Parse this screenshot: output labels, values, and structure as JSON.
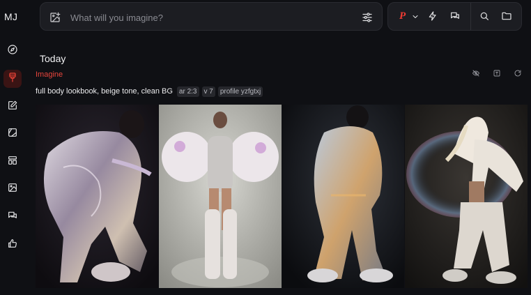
{
  "app": {
    "logo": "MJ"
  },
  "sidebar": {
    "items": [
      {
        "name": "explore",
        "icon": "compass-icon"
      },
      {
        "name": "create",
        "icon": "brush-icon",
        "active": true
      },
      {
        "name": "edit",
        "icon": "edit-icon"
      },
      {
        "name": "personalize",
        "icon": "palette-icon"
      },
      {
        "name": "organize",
        "icon": "layout-icon"
      },
      {
        "name": "gallery",
        "icon": "image-icon"
      },
      {
        "name": "chat",
        "icon": "chat-icon"
      },
      {
        "name": "likes",
        "icon": "thumbs-up-icon"
      }
    ]
  },
  "search": {
    "placeholder": "What will you imagine?",
    "value": ""
  },
  "toolbar": {
    "profile_letter": "P",
    "accent": "#ef3b33"
  },
  "feed": {
    "section_title": "Today",
    "job": {
      "type_label": "Imagine",
      "prompt": "full body lookbook, beige tone, clean BG",
      "params": [
        "ar 2:3",
        "v 7",
        "profile yzfgtxj"
      ],
      "images": [
        {
          "subject": "figure in iridescent sequin oversized outfit"
        },
        {
          "subject": "figure in crystal bodysuit with ruffled sleeves"
        },
        {
          "subject": "figure in iridescent hooded jacket with cargo pants"
        },
        {
          "subject": "figure in white hood with iridescent bubble backdrop"
        }
      ]
    }
  }
}
